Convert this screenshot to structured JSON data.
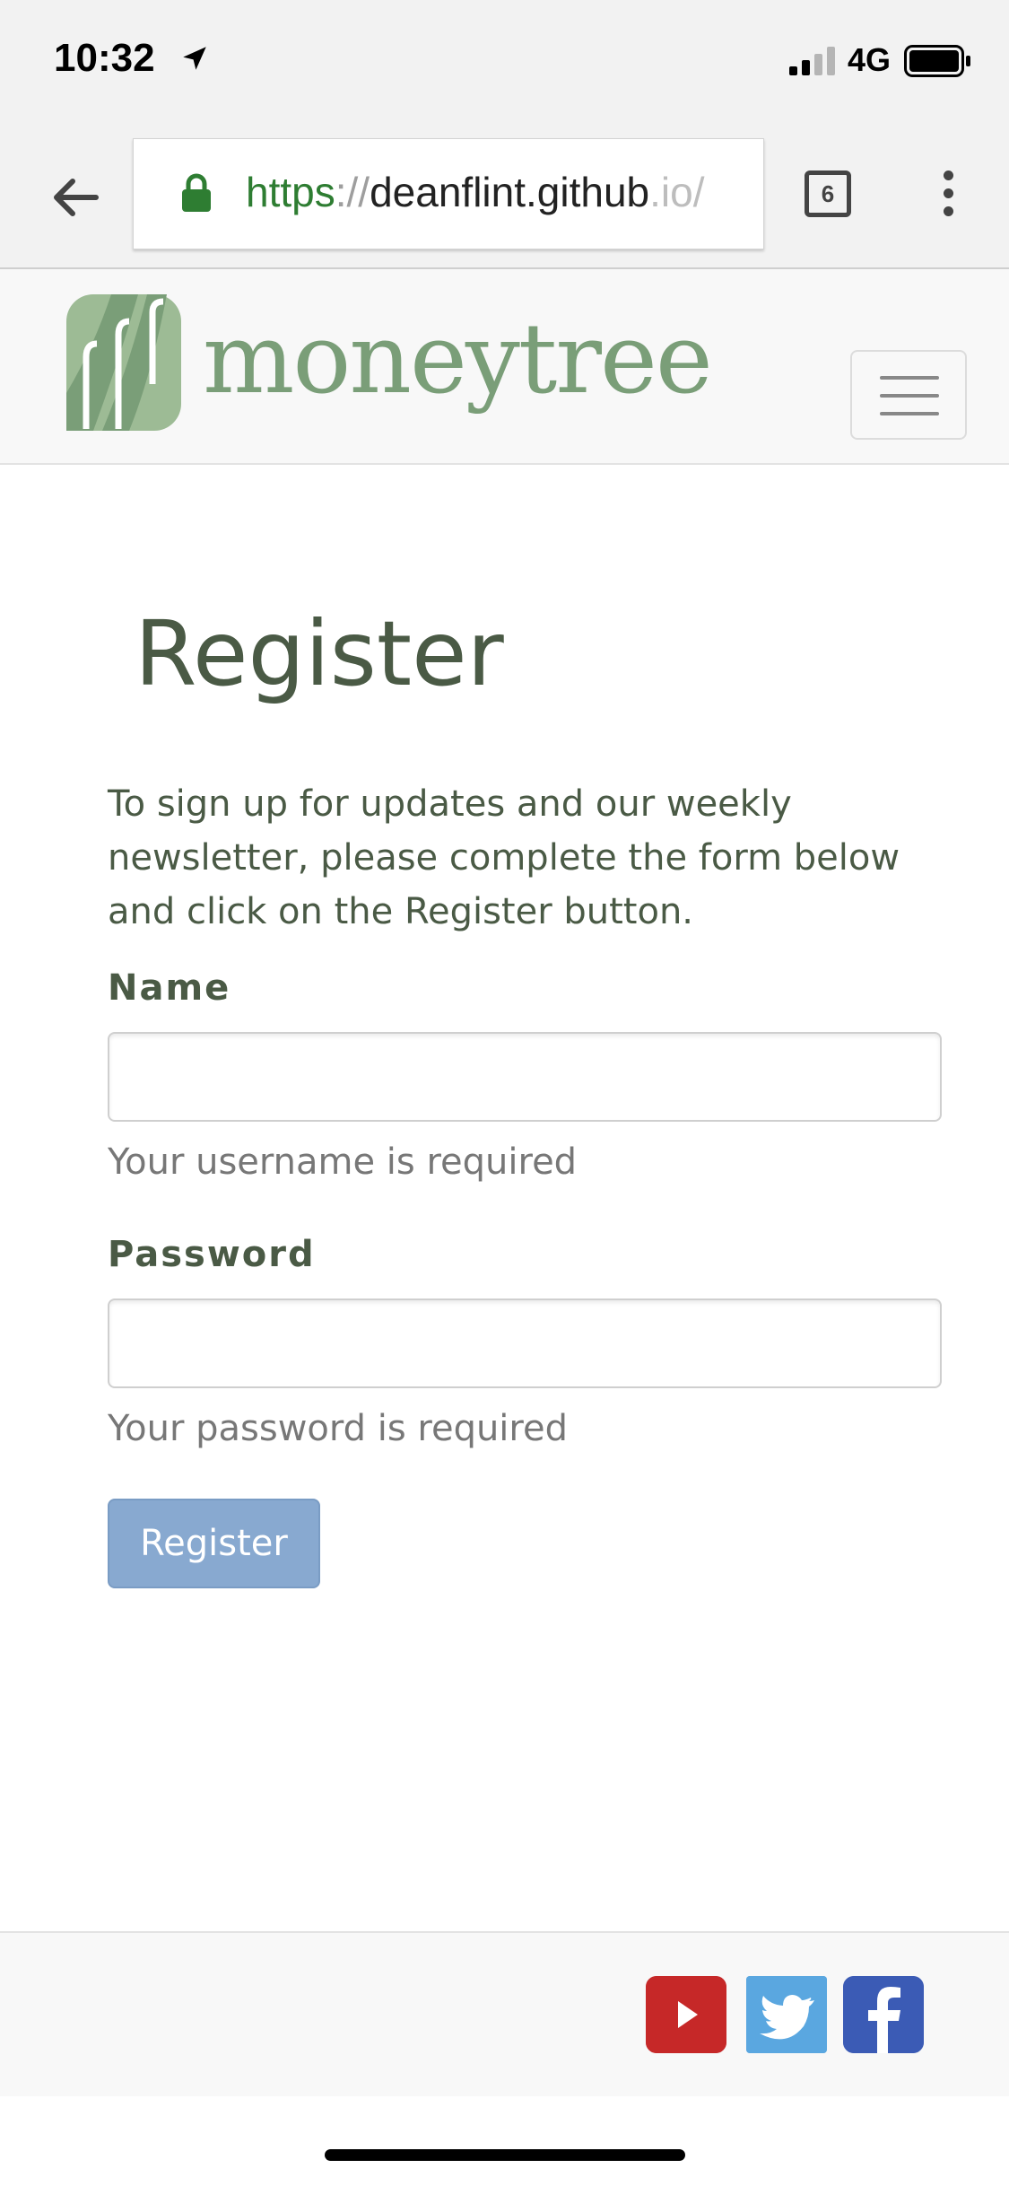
{
  "status_bar": {
    "time": "10:32",
    "network": "4G"
  },
  "browser": {
    "url_scheme": "https",
    "url_separator": "://",
    "url_host": "deanflint.github",
    "url_domain_rest": ".io/",
    "tab_count": "6"
  },
  "site": {
    "logo_text": "moneytree"
  },
  "main": {
    "title": "Register",
    "intro": "To sign up for updates and our weekly newsletter, please complete the form below and click on the Register button.",
    "name_label": "Name",
    "name_value": "",
    "name_help": "Your username is required",
    "password_label": "Password",
    "password_value": "",
    "password_help": "Your password is required",
    "register_button": "Register"
  },
  "footer": {
    "social": [
      "youtube-icon",
      "twitter-icon",
      "facebook-icon"
    ]
  },
  "colors": {
    "brand_green": "#7a9e78",
    "button_blue": "#88a9d0",
    "heading_text": "#4a5a45"
  }
}
